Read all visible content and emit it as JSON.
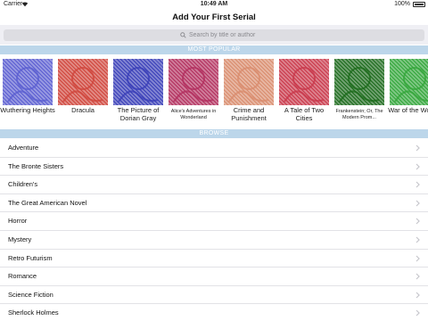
{
  "status_bar": {
    "carrier": "Carrier",
    "time": "10:49 AM",
    "battery": "100%"
  },
  "nav": {
    "title": "Add Your First Serial"
  },
  "search": {
    "placeholder": "Search by title or author"
  },
  "sections": {
    "popular_header": "MOST POPULAR",
    "browse_header": "BROWSE"
  },
  "popular_books": [
    {
      "title": "Wuthering Heights",
      "tint": "#5b5fd1"
    },
    {
      "title": "Dracula",
      "tint": "#d0463c"
    },
    {
      "title": "The Picture of Dorian Gray",
      "tint": "#3a3fb8"
    },
    {
      "title": "Alice's Adventures in Wonderland",
      "tint": "#b3305f"
    },
    {
      "title": "Crime and Punishment",
      "tint": "#d98c6e"
    },
    {
      "title": "A Tale of Two Cities",
      "tint": "#c9384b"
    },
    {
      "title": "Frankenstein; Or, The Modern Prom...",
      "tint": "#1d6b1c"
    },
    {
      "title": "War of the Worlds",
      "tint": "#34a63b"
    }
  ],
  "browse": [
    {
      "label": "Adventure"
    },
    {
      "label": "The Bronte Sisters"
    },
    {
      "label": "Children's"
    },
    {
      "label": "The Great American Novel"
    },
    {
      "label": "Horror"
    },
    {
      "label": "Mystery"
    },
    {
      "label": "Retro Futurism"
    },
    {
      "label": "Romance"
    },
    {
      "label": "Science Fiction"
    },
    {
      "label": "Sherlock Holmes"
    }
  ]
}
